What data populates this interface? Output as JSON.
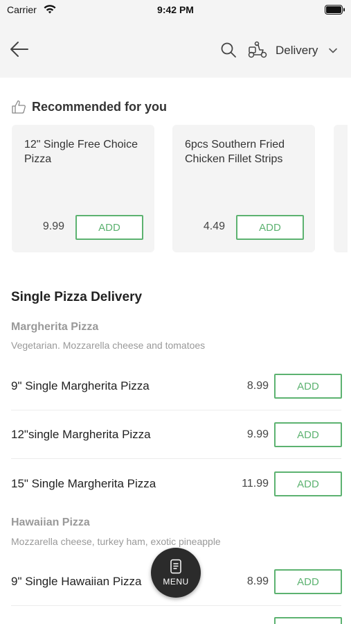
{
  "status_bar": {
    "carrier": "Carrier",
    "time": "9:42 PM"
  },
  "nav": {
    "delivery_label": "Delivery"
  },
  "recommended": {
    "title": "Recommended for you",
    "cards": [
      {
        "name": "12\" Single Free Choice Pizza",
        "price": "9.99",
        "add_label": "ADD"
      },
      {
        "name": "6pcs Southern Fried Chicken Fillet Strips",
        "price": "4.49",
        "add_label": "ADD"
      }
    ]
  },
  "section": {
    "title": "Single Pizza Delivery",
    "categories": [
      {
        "name": "Margherita Pizza",
        "description": "Vegetarian. Mozzarella cheese and tomatoes",
        "items": [
          {
            "name": "9\" Single Margherita Pizza",
            "price": "8.99",
            "add_label": "ADD"
          },
          {
            "name": "12\"single Margherita Pizza",
            "price": "9.99",
            "add_label": "ADD"
          },
          {
            "name": "15\" Single Margherita Pizza",
            "price": "11.99",
            "add_label": "ADD"
          }
        ]
      },
      {
        "name": "Hawaiian Pizza",
        "description": "Mozzarella cheese, turkey ham, exotic pineapple",
        "items": [
          {
            "name": "9\" Single Hawaiian Pizza",
            "price": "8.99",
            "add_label": "ADD"
          }
        ]
      }
    ]
  },
  "menu_button": {
    "label": "MENU"
  },
  "colors": {
    "accent": "#5cb270",
    "header_bg": "#f4f4f4",
    "fab_bg": "#2b2b2b"
  }
}
